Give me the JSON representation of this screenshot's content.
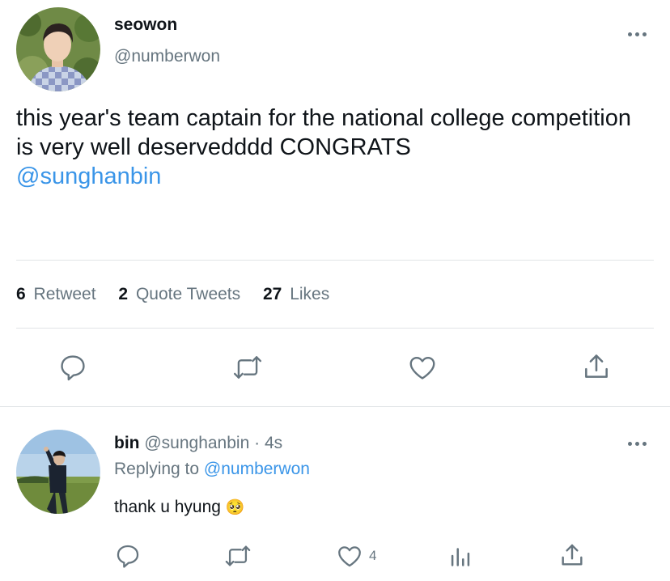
{
  "tweet": {
    "display_name": "seowon",
    "handle": "@numberwon",
    "text": "this year's team captain for the national college competition is very well deservedddd CONGRATS",
    "mention": "@sunghanbin",
    "stats": {
      "retweets_count": "6",
      "retweets_label": "Retweet",
      "quotes_count": "2",
      "quotes_label": "Quote Tweets",
      "likes_count": "27",
      "likes_label": "Likes"
    },
    "actions": [
      "reply-icon",
      "retweet-icon",
      "like-icon",
      "share-icon"
    ]
  },
  "reply": {
    "display_name": "bin",
    "handle": "@sunghanbin",
    "separator": "·",
    "time": "4s",
    "replying_prefix": "Replying to",
    "replying_handle": "@numberwon",
    "text": "thank u hyung",
    "emoji": "🥺",
    "like_count": "4",
    "actions": [
      "reply-icon",
      "retweet-icon",
      "like-icon",
      "analytics-icon",
      "share-icon"
    ]
  },
  "colors": {
    "link": "#3a95e8",
    "muted": "#66757f",
    "divider": "#e1e4e6",
    "icon": "#66757f"
  }
}
